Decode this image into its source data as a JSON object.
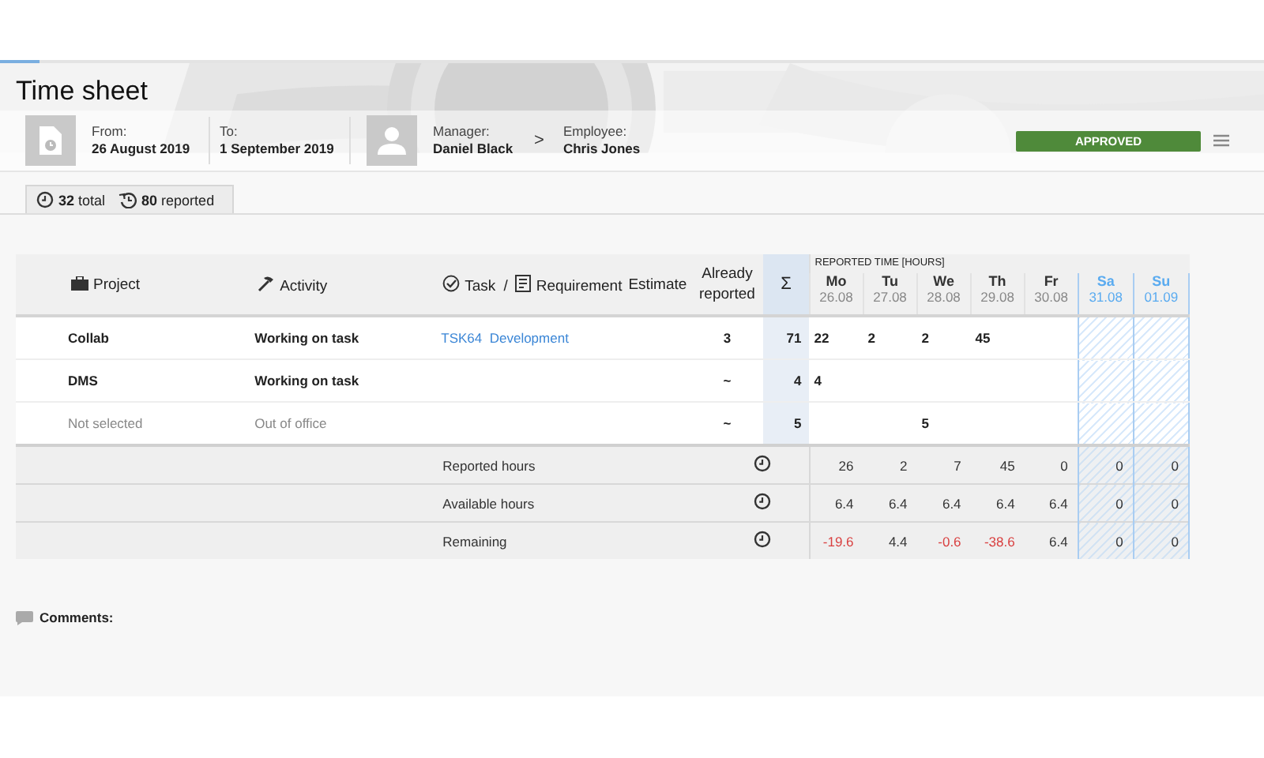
{
  "header": {
    "title": "Time sheet",
    "from_label": "From:",
    "from": "26 August 2019",
    "to_label": "To:",
    "to": "1 September 2019",
    "manager_label": "Manager:",
    "manager": "Daniel Black",
    "separator": ">",
    "employee_label": "Employee:",
    "employee": "Chris Jones",
    "status": "APPROVED"
  },
  "stats": {
    "total": "**32** total",
    "reported": "**80** reported"
  },
  "table": {
    "columns": [
      {
        "kind": "project",
        "label": "Project"
      },
      {
        "kind": "activity",
        "label": "Activity"
      },
      {
        "kind": "task",
        "label": "Task",
        "separator": "/",
        "label2": "Requirement"
      },
      {
        "kind": "estimate",
        "label": "Estimate"
      },
      {
        "kind": "already",
        "label": "Already reported"
      },
      {
        "kind": "sum",
        "label": "Σ"
      }
    ],
    "reported_time_label": "REPORTED TIME [HOURS]",
    "days": [
      {
        "day": "Mo",
        "date": "26.08",
        "weekend": false
      },
      {
        "day": "Tu",
        "date": "27.08",
        "weekend": false
      },
      {
        "day": "We",
        "date": "28.08",
        "weekend": false
      },
      {
        "day": "Th",
        "date": "29.08",
        "weekend": false
      },
      {
        "day": "Fr",
        "date": "30.08",
        "weekend": false
      },
      {
        "day": "Sa",
        "date": "31.08",
        "weekend": true
      },
      {
        "day": "Su",
        "date": "01.09",
        "weekend": true
      }
    ],
    "rows": [
      {
        "project": "Collab",
        "activity": "Working on task",
        "task": "TSK64  Development",
        "already_reported": "3",
        "sum": "71",
        "muted": false,
        "hours": {
          "day_1": "22",
          "day_2": "2",
          "day_3": "2",
          "day_4": "45"
        }
      },
      {
        "project": "DMS",
        "activity": "Working on task",
        "already_reported": "~",
        "sum": "4",
        "muted": false,
        "hours": {
          "day_1": "4"
        }
      },
      {
        "project": "Not selected",
        "activity": "Out of office",
        "already_reported": "~",
        "sum": "5",
        "muted": true,
        "hours": {
          "day_3": "5"
        }
      }
    ],
    "summary": [
      {
        "label": "Reported hours",
        "values": [
          {
            "text": "26",
            "negative": false
          },
          {
            "text": "2",
            "negative": false
          },
          {
            "text": "7",
            "negative": false
          },
          {
            "text": "45",
            "negative": false
          },
          {
            "text": "0",
            "negative": false
          },
          {
            "text": "0",
            "negative": false
          },
          {
            "text": "0",
            "negative": false
          }
        ]
      },
      {
        "label": "Available hours",
        "values": [
          {
            "text": "6.4",
            "negative": false
          },
          {
            "text": "6.4",
            "negative": false
          },
          {
            "text": "6.4",
            "negative": false
          },
          {
            "text": "6.4",
            "negative": false
          },
          {
            "text": "6.4",
            "negative": false
          },
          {
            "text": "0",
            "negative": false
          },
          {
            "text": "0",
            "negative": false
          }
        ]
      },
      {
        "label": "Remaining",
        "values": [
          {
            "text": "-19.6",
            "negative": true
          },
          {
            "text": "4.4",
            "negative": false
          },
          {
            "text": "-0.6",
            "negative": true
          },
          {
            "text": "-38.6",
            "negative": true
          },
          {
            "text": "6.4",
            "negative": false
          },
          {
            "text": "0",
            "negative": false
          },
          {
            "text": "0",
            "negative": false
          }
        ]
      }
    ]
  },
  "comments_label": "Comments:"
}
